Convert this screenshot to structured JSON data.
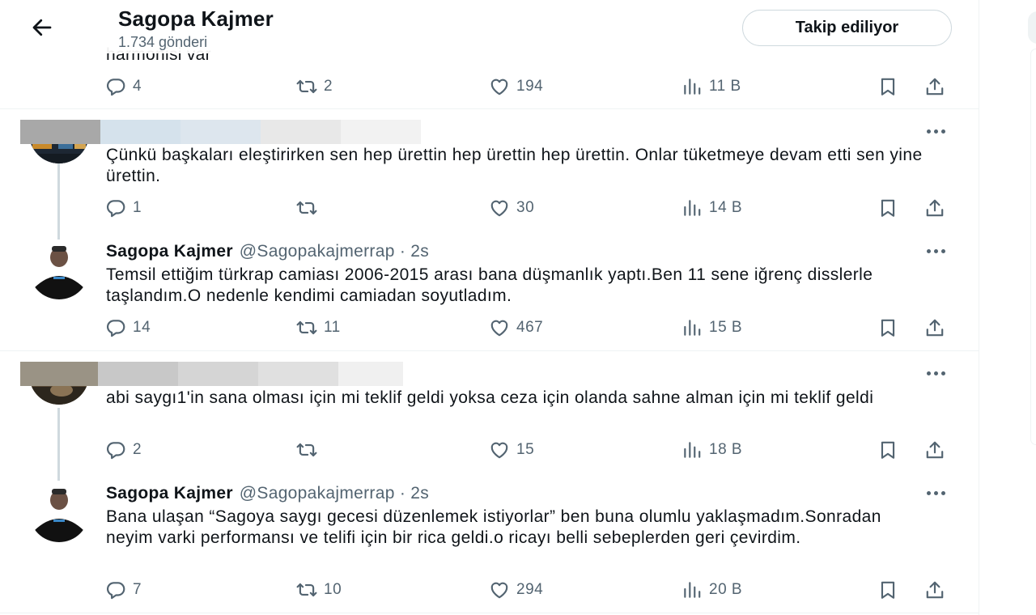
{
  "header": {
    "name": "Sagopa Kajmer",
    "post_count": "1.734 gönderi",
    "follow_label": "Takip ediliyor"
  },
  "prev_tweet": {
    "cut_text": "harmonisi var",
    "replies": "4",
    "retweets": "2",
    "likes": "194",
    "views": "11 B"
  },
  "tweets": [
    {
      "text": "Çünkü başkaları eleştirirken sen hep ürettin hep ürettin hep ürettin. Onlar tüketmeye devam etti sen yine ürettin.",
      "replies": "1",
      "retweets": "",
      "likes": "30",
      "views": "14 B"
    },
    {
      "name": "Sagopa Kajmer",
      "handle": "@Sagopakajmerrap · 2s",
      "text": "Temsil ettiğim türkrap camiası 2006-2015 arası bana düşmanlık yaptı.Ben 11 sene iğrenç disslerle taşlandım.O nedenle kendimi camiadan soyutladım.",
      "replies": "14",
      "retweets": "11",
      "likes": "467",
      "views": "15 B"
    },
    {
      "text": "abi saygı1'in sana olması için mi teklif geldi yoksa ceza için olanda sahne alman için mi teklif geldi",
      "replies": "2",
      "retweets": "",
      "likes": "15",
      "views": "18 B"
    },
    {
      "name": "Sagopa Kajmer",
      "handle": "@Sagopakajmerrap · 2s",
      "text": "Bana ulaşan “Sagoya saygı gecesi düzenlemek istiyorlar” ben buna olumlu yaklaşmadım.Sonradan neyim varki performansı ve telifi için bir rica geldi.o ricayı belli sebeplerden geri çevirdim.",
      "replies": "7",
      "retweets": "10",
      "likes": "294",
      "views": "20 B"
    }
  ],
  "icons": {
    "back": "arrow-left-icon",
    "reply": "reply-icon",
    "retweet": "retweet-icon",
    "like": "heart-icon",
    "views": "views-icon",
    "bookmark": "bookmark-icon",
    "share": "share-icon",
    "more": "more-icon"
  },
  "colors": {
    "text": "#0f1419",
    "secondary": "#536471",
    "border": "#eff3f4"
  }
}
